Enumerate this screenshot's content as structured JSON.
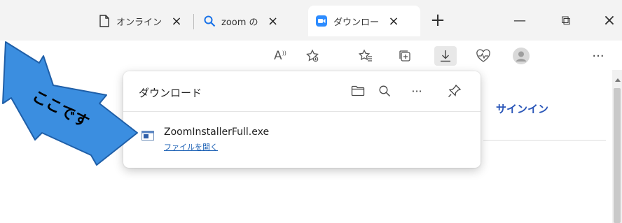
{
  "tabs": [
    {
      "title": "オンライン",
      "icon": "page-icon"
    },
    {
      "title": "zoom の",
      "icon": "search-icon"
    },
    {
      "title": "ダウンロー",
      "icon": "zoom-icon",
      "active": true
    }
  ],
  "tab_close_glyph": "×",
  "new_tab_glyph": "+",
  "window_controls": {
    "minimize": "—",
    "restore": "⧉",
    "close": "×"
  },
  "toolbar": {
    "read_aloud": "A",
    "more": "···"
  },
  "page": {
    "signin": "サインイン"
  },
  "downloads": {
    "title": "ダウンロード",
    "more": "···",
    "item": {
      "file_name": "ZoomInstallerFull.exe",
      "open_link": "ファイルを開く"
    }
  },
  "annotation": {
    "text": "ここです"
  },
  "colors": {
    "arrow_fill": "#3b8ee0",
    "arrow_stroke": "#1f5fa8",
    "link": "#1a5fb4",
    "signin": "#2a56b8",
    "zoom_icon": "#2d8cff"
  }
}
